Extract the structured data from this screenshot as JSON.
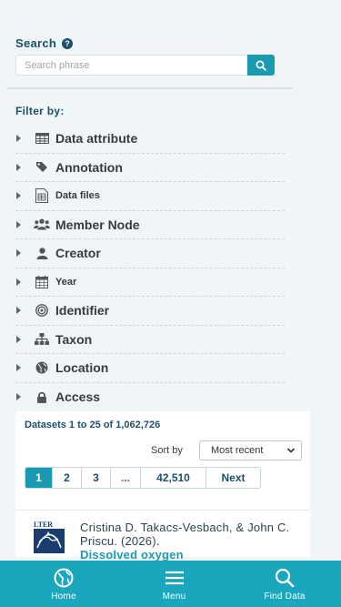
{
  "search": {
    "label": "Search",
    "placeholder": "Search phrase"
  },
  "filters": {
    "heading": "Filter by:",
    "items": [
      {
        "label": "Data attribute",
        "icon": "table-icon"
      },
      {
        "label": "Annotation",
        "icon": "tag-icon"
      },
      {
        "label": "Data files",
        "icon": "file-table-icon"
      },
      {
        "label": "Member Node",
        "icon": "users-icon"
      },
      {
        "label": "Creator",
        "icon": "user-icon"
      },
      {
        "label": "Year",
        "icon": "calendar-icon"
      },
      {
        "label": "Identifier",
        "icon": "bullseye-icon"
      },
      {
        "label": "Taxon",
        "icon": "sitemap-icon"
      },
      {
        "label": "Location",
        "icon": "globe-icon"
      },
      {
        "label": "Access",
        "icon": "lock-icon"
      }
    ]
  },
  "results": {
    "count_text": "Datasets 1 to 25 of 1,062,726",
    "sort_label": "Sort by",
    "sort_selected": "Most recent",
    "pages": [
      "1",
      "2",
      "3",
      "...",
      "42,510",
      "Next"
    ],
    "first_result": {
      "logo_text": "LTER",
      "authors": "Cristina D. Takacs-Vesbach, & John C. Priscu. (2026).",
      "title": "Dissolved oxygen"
    }
  },
  "bottom_nav": [
    {
      "label": "Home",
      "icon": "globe-icon"
    },
    {
      "label": "Menu",
      "icon": "hamburger-icon"
    },
    {
      "label": "Find Data",
      "icon": "search-icon"
    }
  ],
  "colors": {
    "accent": "#1a9ab1",
    "nav_bg": "#1aa6bc",
    "heading": "#1c4f6b"
  }
}
